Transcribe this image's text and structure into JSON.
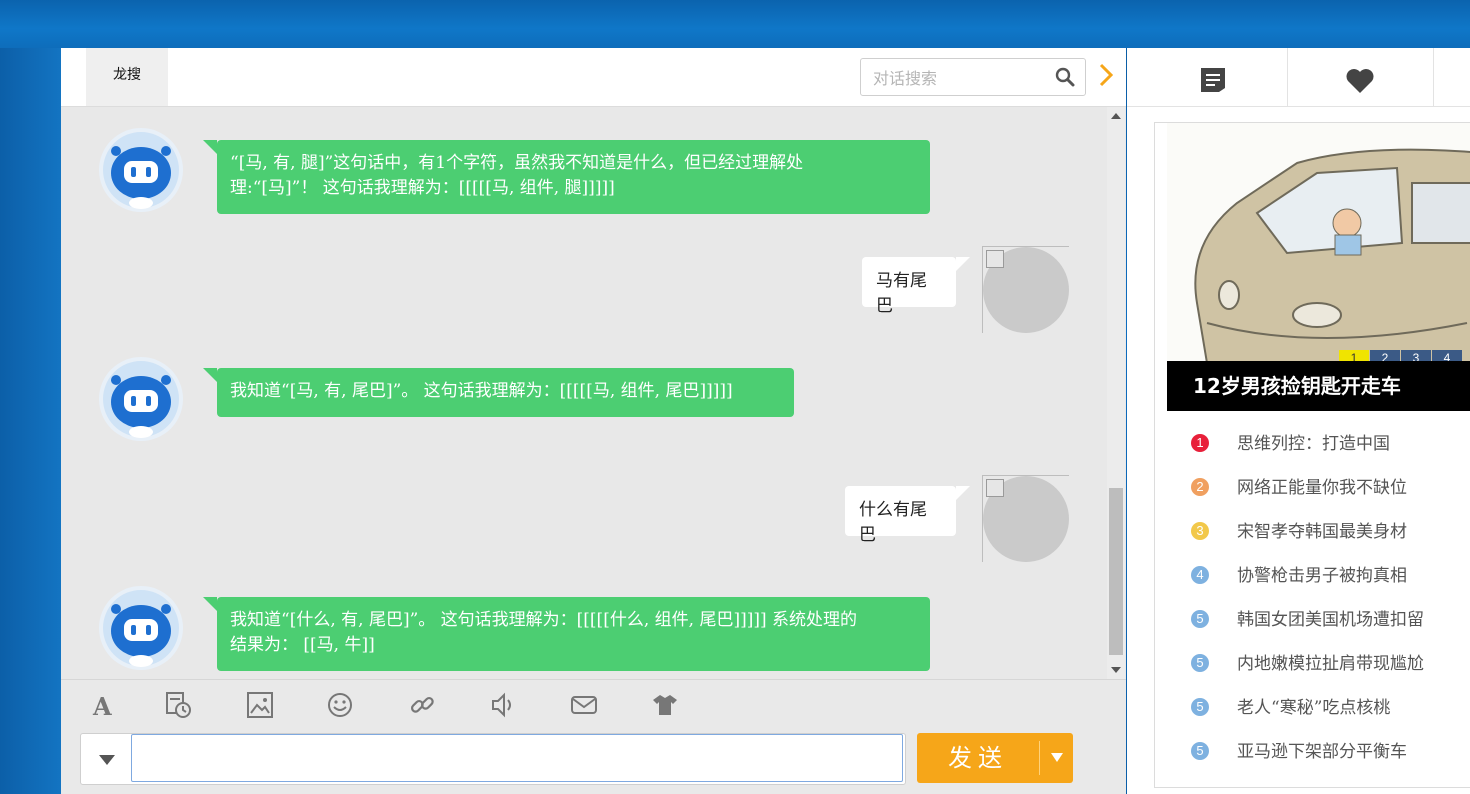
{
  "chat": {
    "tab_label": "龙搜",
    "search_placeholder": "对话搜索",
    "messages": [
      {
        "from": "bot",
        "lines": [
          "“[马, 有, 腿]”这句话中，有1个字符，虽然我不知道是什么，但已经过理解处",
          "理:“[马]”！ 这句话我理解为：[[[[[马, 组件, 腿]]]]]"
        ]
      },
      {
        "from": "user",
        "lines": [
          "马有尾巴"
        ]
      },
      {
        "from": "bot",
        "lines": [
          "我知道“[马, 有, 尾巴]”。 这句话我理解为：[[[[[马, 组件, 尾巴]]]]]"
        ]
      },
      {
        "from": "user",
        "lines": [
          "什么有尾巴"
        ]
      },
      {
        "from": "bot",
        "lines": [
          "我知道“[什么, 有, 尾巴]”。 这句话我理解为：[[[[[什么, 组件, 尾巴]]]]] 系统处理的",
          "结果为： [[马, 牛]]"
        ]
      }
    ],
    "toolbar": [
      "font-icon",
      "history-icon",
      "image-icon",
      "emoji-icon",
      "link-icon",
      "sound-icon",
      "mail-icon",
      "shirt-icon"
    ],
    "input_value": "",
    "send_label": "发送"
  },
  "right_panel": {
    "tabs": [
      "notes-icon",
      "heart-icon"
    ],
    "pager": [
      "1",
      "2",
      "3",
      "4"
    ],
    "headline": "12岁男孩捡钥匙开走车",
    "news": [
      {
        "num": "1",
        "color": "#e8203a",
        "text": "思维列控：打造中国"
      },
      {
        "num": "2",
        "color": "#f0a060",
        "text": "网络正能量你我不缺位"
      },
      {
        "num": "3",
        "color": "#f2c84a",
        "text": "宋智孝夺韩国最美身材"
      },
      {
        "num": "4",
        "color": "#7eb1e0",
        "text": "协警枪击男子被拘真相"
      },
      {
        "num": "5",
        "color": "#7eb1e0",
        "text": "韩国女团美国机场遭扣留"
      },
      {
        "num": "5",
        "color": "#7eb1e0",
        "text": "内地嫩模拉扯肩带现尴尬"
      },
      {
        "num": "5",
        "color": "#7eb1e0",
        "text": "老人“寒秘”吃点核桃"
      },
      {
        "num": "5",
        "color": "#7eb1e0",
        "text": "亚马逊下架部分平衡车"
      }
    ]
  },
  "colors": {
    "bot_bubble": "#4cce72",
    "send_button": "#f6a619",
    "background_blue": "#0d6cbf"
  }
}
